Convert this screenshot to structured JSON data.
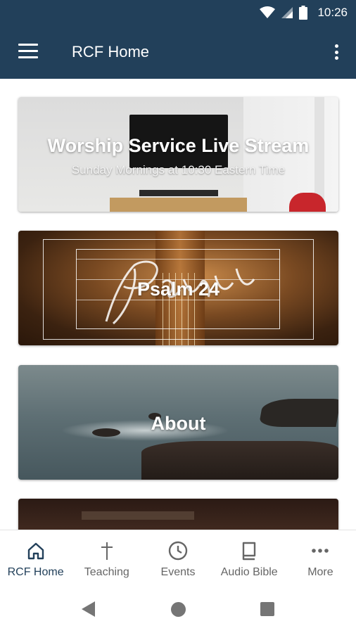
{
  "status_bar": {
    "time": "10:26",
    "icons": [
      "wifi-icon",
      "cell-signal-icon",
      "battery-icon"
    ]
  },
  "app_bar": {
    "title": "RCF Home",
    "menu_icon": "hamburger-menu-icon",
    "overflow_icon": "more-vert-icon",
    "background": "#22405a"
  },
  "cards": [
    {
      "title": "Worship Service Live Stream",
      "subtitle": "Sunday Mornings at 10:30 Eastern Time"
    },
    {
      "title": "Psalm 24",
      "subtitle": ""
    },
    {
      "title": "About",
      "subtitle": ""
    },
    {
      "title": "",
      "subtitle": ""
    }
  ],
  "bottom_nav": {
    "items": [
      {
        "label": "RCF Home",
        "icon": "home-icon",
        "active": true
      },
      {
        "label": "Teaching",
        "icon": "cross-icon",
        "active": false
      },
      {
        "label": "Events",
        "icon": "clock-icon",
        "active": false
      },
      {
        "label": "Audio Bible",
        "icon": "book-icon",
        "active": false
      },
      {
        "label": "More",
        "icon": "more-horiz-icon",
        "active": false
      }
    ],
    "active_color": "#22405a",
    "inactive_color": "#666666"
  },
  "system_nav": {
    "buttons": [
      "back-icon",
      "home-circle-icon",
      "recents-icon"
    ]
  }
}
